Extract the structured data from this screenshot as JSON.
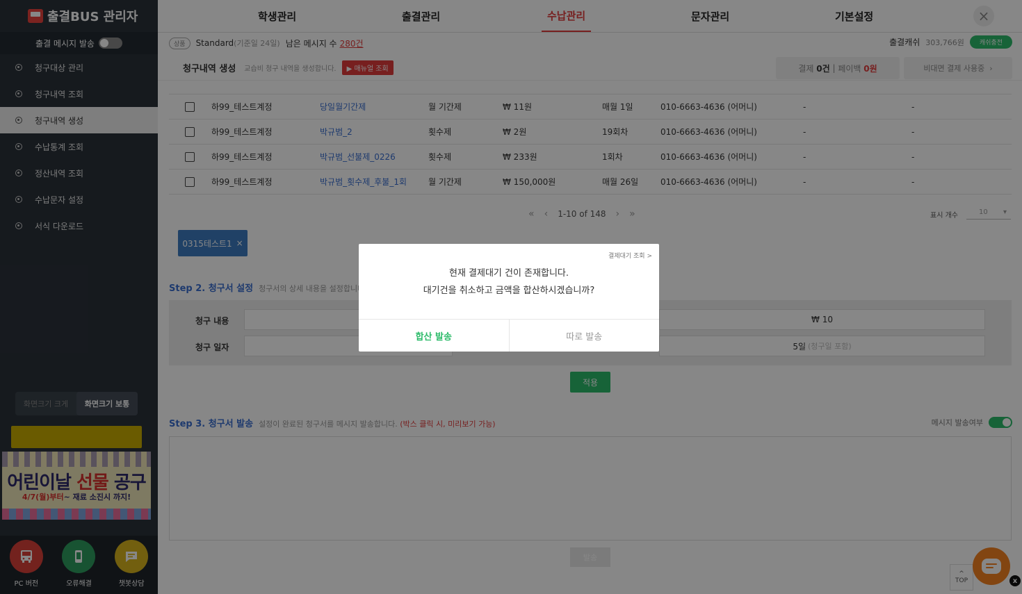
{
  "app": {
    "title": "출결BUS 관리자"
  },
  "sidebar": {
    "message_toggle_label": "출결 메시지 발송",
    "items": [
      {
        "label": "청구대상 관리"
      },
      {
        "label": "청구내역 조회"
      },
      {
        "label": "청구내역 생성"
      },
      {
        "label": "수납통계 조회"
      },
      {
        "label": "정산내역 조회"
      },
      {
        "label": "수납문자 설정"
      },
      {
        "label": "서식 다운로드"
      }
    ],
    "size_large": "화면크기 크게",
    "size_normal": "화면크기 보통",
    "banner": {
      "title_a": "어린이날 ",
      "title_b": "선물",
      "title_c": " 공구",
      "sub_a": "4/7(월)부터",
      "sub_b": "~ 재료 소진시 까지!"
    },
    "bottom": [
      {
        "label": "PC 버전",
        "color": "#d9403a"
      },
      {
        "label": "오류해결",
        "color": "#2e9e5f"
      },
      {
        "label": "챗봇상담",
        "color": "#d8b41e"
      }
    ]
  },
  "topnav": {
    "tabs": [
      {
        "label": "학생관리"
      },
      {
        "label": "출결관리"
      },
      {
        "label": "수납관리"
      },
      {
        "label": "문자관리"
      },
      {
        "label": "기본설정"
      }
    ],
    "active": "수납관리"
  },
  "infobar": {
    "tag": "상품",
    "plan": "Standard",
    "plan_note": "(기준일 24일)",
    "remain_label": "남은 메시지 수",
    "remain_value": "280건",
    "cash_label": "출결캐쉬",
    "cash_value": "303,766원",
    "cash_button": "캐쉬충전"
  },
  "pagehead": {
    "title": "청구내역 생성",
    "desc": "교습비 청구 내역을 생성합니다.",
    "manual_button": "▶ 매뉴얼 조회",
    "pay_label": "결제",
    "pay_count": "0건",
    "payback_label": "페이백",
    "payback_value": "0원",
    "nonface_label": "비대면 결제 사용중",
    "nonface_arrow": "›"
  },
  "table": {
    "rows": [
      {
        "account": "하99_테스트계정",
        "name": "당일월기간제",
        "type": "월 기간제",
        "amount": "₩ 11원",
        "cycle": "매월 1일",
        "phone": "010-6663-4636 (어머니)",
        "c1": "-",
        "c2": "-"
      },
      {
        "account": "하99_테스트계정",
        "name": "박규범_2",
        "type": "횟수제",
        "amount": "₩ 2원",
        "cycle": "19회차",
        "phone": "010-6663-4636 (어머니)",
        "c1": "-",
        "c2": "-"
      },
      {
        "account": "하99_테스트계정",
        "name": "박규범_선불제_0226",
        "type": "횟수제",
        "amount": "₩ 233원",
        "cycle": "1회차",
        "phone": "010-6663-4636 (어머니)",
        "c1": "-",
        "c2": "-"
      },
      {
        "account": "하99_테스트계정",
        "name": "박규범_횟수제_후불_1회",
        "type": "월 기간제",
        "amount": "₩ 150,000원",
        "cycle": "매월 26일",
        "phone": "010-6663-4636 (어머니)",
        "c1": "-",
        "c2": "-"
      }
    ]
  },
  "pager": {
    "range": "1-10 of 148",
    "per_page_label": "표시 개수",
    "per_page_value": "10"
  },
  "chip": {
    "label": "0315테스트1",
    "close": "×"
  },
  "step2": {
    "title": "Step 2. 청구서 설정",
    "desc": "청구서의 상세 내용을 설정합니다.",
    "content_label": "청구 내용",
    "date_label": "청구 일자",
    "amount_value": "₩ 10",
    "date_value": "5일",
    "date_note": "(청구일 포함)",
    "apply_button": "적용"
  },
  "step3": {
    "title": "Step 3. 청구서 발송",
    "desc": "설정이 완료된 청구서를 메시지 발송합니다.",
    "desc_red": "(박스 클릭 시, 미리보기 가능)",
    "toggle_label": "메시지 발송여부",
    "send_button": "발송"
  },
  "float": {
    "top_label": "TOP",
    "top_arrow": "^",
    "close": "x"
  },
  "modal": {
    "link": "결제대기 조회 >",
    "line1": "현재 결제대기 건이 존재합니다.",
    "line2": "대기건을 취소하고 금액을 합산하시겠습니까?",
    "confirm": "합산 발송",
    "separate": "따로 발송"
  },
  "icons": {
    "close": "×",
    "pager_first": "«",
    "pager_prev": "‹",
    "pager_next": "›",
    "pager_last": "»",
    "dropdown": "▾"
  },
  "colors": {
    "accent_green": "#2dbb6a",
    "accent_red": "#e03b3b",
    "link_blue": "#3a6fd0",
    "sidebar_bg": "#2b323a"
  }
}
